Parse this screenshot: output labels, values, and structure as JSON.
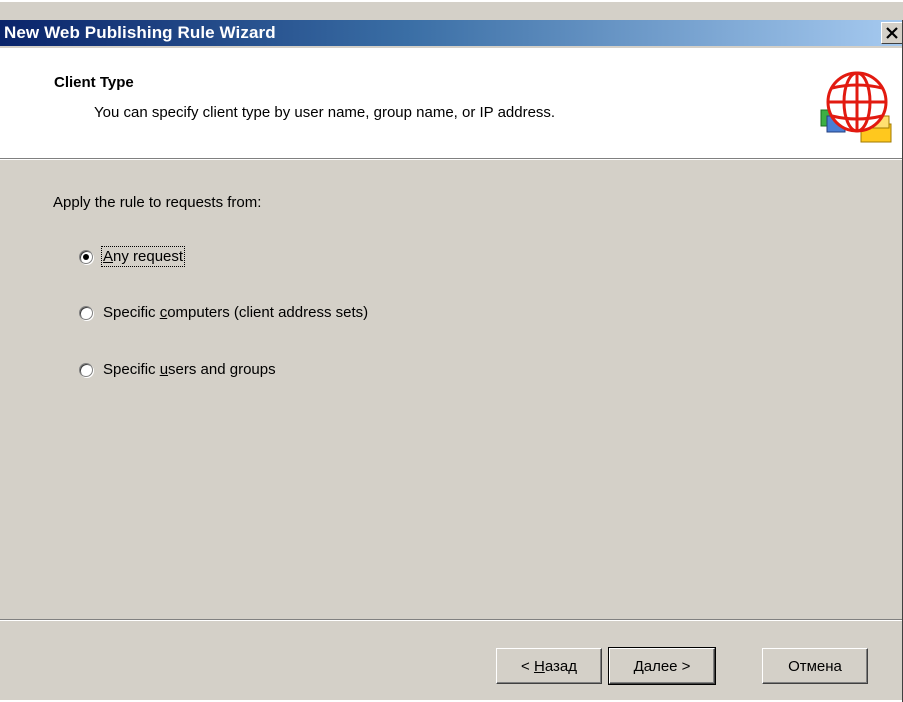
{
  "window": {
    "title": "New Web Publishing Rule Wizard",
    "close_symbol": "✕"
  },
  "header": {
    "title": "Client Type",
    "description": "You can specify client type by user name, group name, or IP address.",
    "icon": "globe-icon"
  },
  "body": {
    "prompt": "Apply the rule to requests from:",
    "options": [
      {
        "pre": "",
        "accel": "A",
        "post": "ny request",
        "checked": true
      },
      {
        "pre": "Specific ",
        "accel": "c",
        "post": "omputers (client address sets)",
        "checked": false
      },
      {
        "pre": "Specific ",
        "accel": "u",
        "post": "sers and groups",
        "checked": false
      }
    ]
  },
  "footer": {
    "back": {
      "pre": "< ",
      "accel": "Н",
      "post": "азад"
    },
    "next": {
      "label": "Далее >"
    },
    "cancel": {
      "label": "Отмена"
    }
  },
  "colors": {
    "titlebar_start": "#0a246a",
    "titlebar_end": "#a6caf0",
    "dialog_bg": "#d4d0c8"
  }
}
